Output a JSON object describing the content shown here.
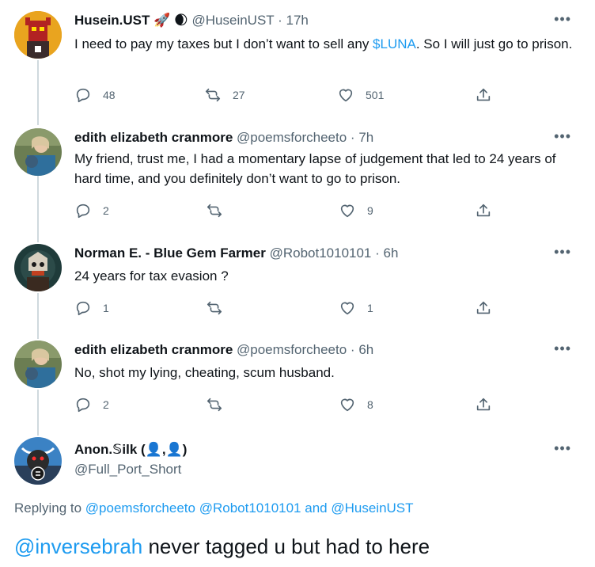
{
  "tweets": [
    {
      "name": "Husein.UST",
      "name_emoji": "🚀 🌒",
      "handle": "@HuseinUST",
      "time": "17h",
      "text_before": "I need to pay my taxes but I don’t want to sell any ",
      "cashtag": "$LUNA",
      "text_after": ". So I will just go to prison.",
      "replies": "48",
      "retweets": "27",
      "likes": "501"
    },
    {
      "name": "edith elizabeth cranmore",
      "handle": "@poemsforcheeto",
      "time": "7h",
      "text": "My friend, trust me, I had a momentary lapse of judgement that led to 24 years of hard time, and you definitely don’t want to go to prison.",
      "replies": "2",
      "retweets": "",
      "likes": "9"
    },
    {
      "name": "Norman E. - Blue Gem Farmer",
      "handle": "@Robot1010101",
      "time": "6h",
      "text": "24 years for tax evasion ?",
      "replies": "1",
      "retweets": "",
      "likes": "1"
    },
    {
      "name": "edith elizabeth cranmore",
      "handle": "@poemsforcheeto",
      "time": "6h",
      "text": "No, shot my lying, cheating, scum husband.",
      "replies": "2",
      "retweets": "",
      "likes": "8"
    }
  ],
  "main_tweet": {
    "name": "Anon.𝕊ilk (👤,👤)",
    "handle": "@Full_Port_Short",
    "replying_prefix": "Replying to",
    "replying_to_1": "@poemsforcheeto",
    "replying_to_2": "@Robot1010101",
    "replying_and": "and",
    "replying_to_3": "@HuseinUST",
    "mention": "@inversebrah",
    "text": " never tagged u but had to here"
  },
  "ui": {
    "separator": "·",
    "more": "•••"
  },
  "colors": {
    "link": "#1d9bf0",
    "secondary": "#536471",
    "thread_line": "#cfd9de"
  }
}
